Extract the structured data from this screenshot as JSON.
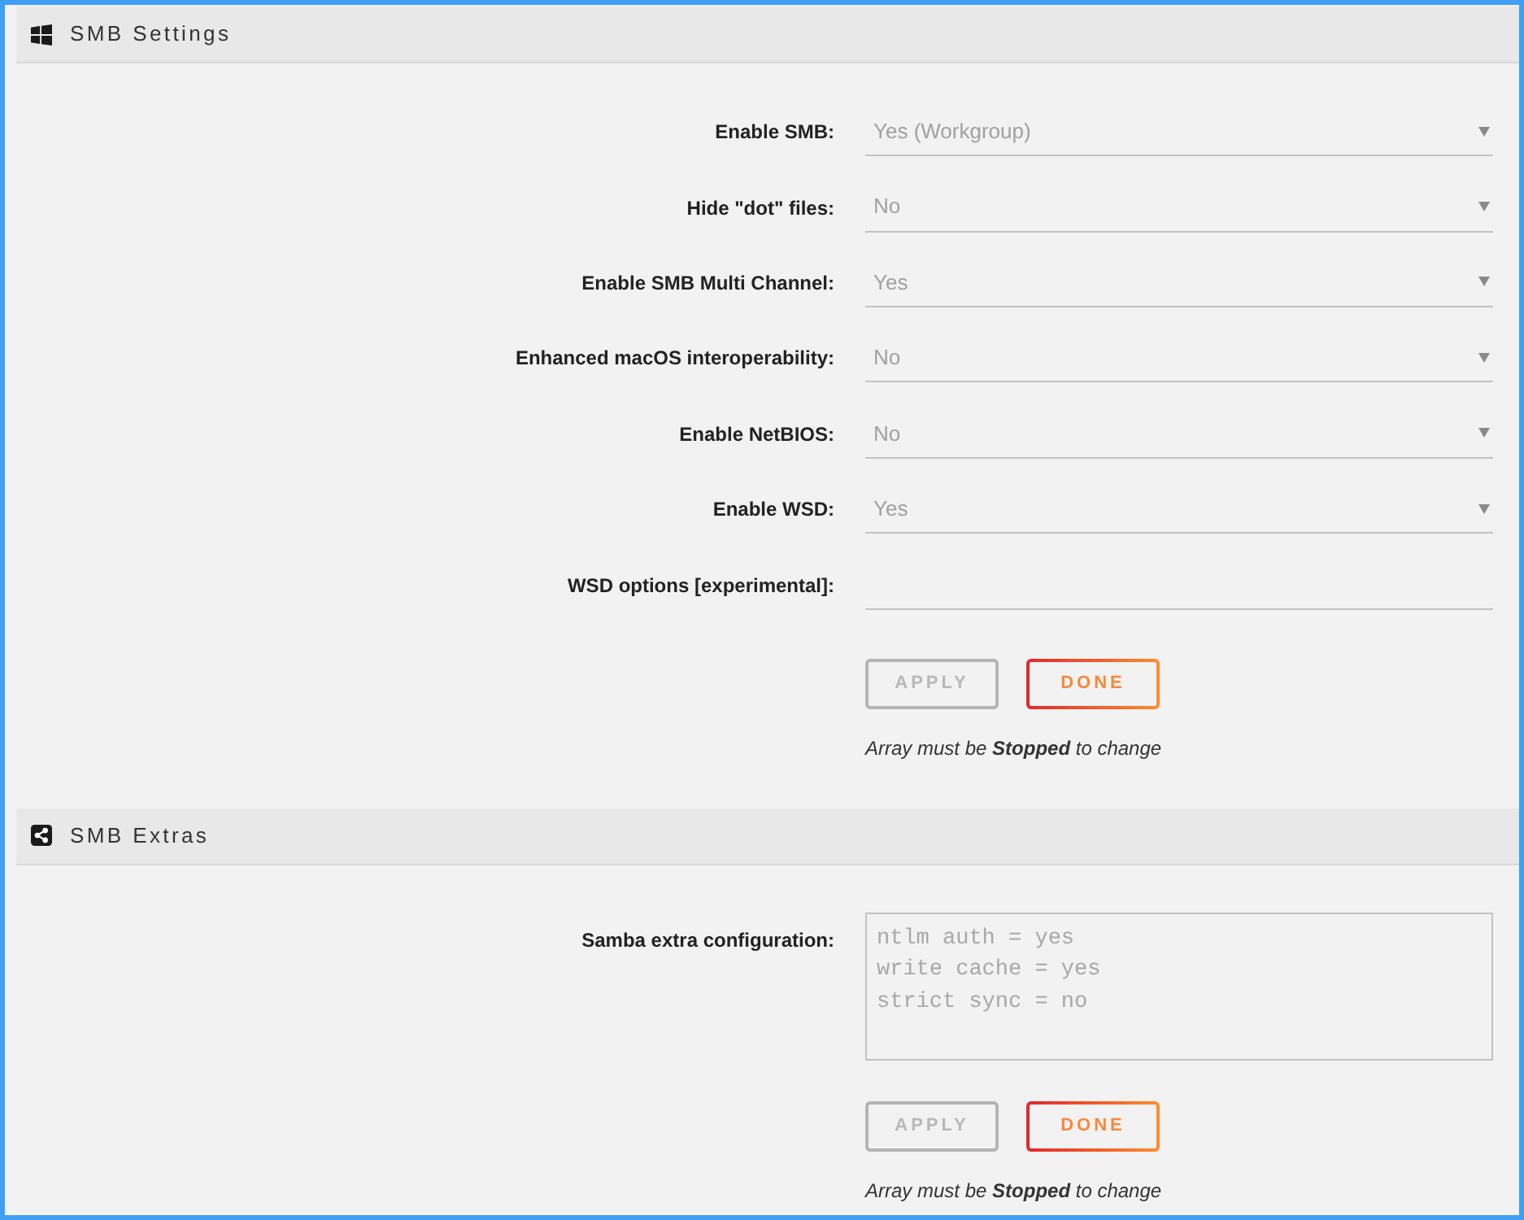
{
  "sections": [
    {
      "title": "SMB Settings",
      "fields": [
        {
          "kind": "select",
          "label": "Enable SMB:",
          "value": "Yes (Workgroup)",
          "disabled": true
        },
        {
          "kind": "select",
          "label": "Hide \"dot\" files:",
          "value": "No",
          "disabled": true
        },
        {
          "kind": "select",
          "label": "Enable SMB Multi Channel:",
          "value": "Yes",
          "disabled": true
        },
        {
          "kind": "select",
          "label": "Enhanced macOS interoperability:",
          "value": "No",
          "disabled": true
        },
        {
          "kind": "select",
          "label": "Enable NetBIOS:",
          "value": "No",
          "disabled": true
        },
        {
          "kind": "select",
          "label": "Enable WSD:",
          "value": "Yes",
          "disabled": true
        },
        {
          "kind": "text",
          "label": "WSD options [experimental]:"
        }
      ],
      "buttons": [
        {
          "label": "APPLY",
          "disabled": true
        },
        {
          "label": "DONE",
          "disabled": false
        }
      ],
      "note": "Array must be **Stopped** to change"
    },
    {
      "title": "SMB Extras",
      "fields": [
        {
          "kind": "textarea",
          "label": "Samba extra configuration:",
          "value": "ntlm auth = yes\nwrite cache = yes\nstrict sync = no",
          "disabled": true
        }
      ],
      "buttons": [
        {
          "label": "APPLY",
          "disabled": true
        },
        {
          "label": "DONE",
          "disabled": false
        }
      ],
      "note": "Array must be **Stopped** to change"
    }
  ]
}
